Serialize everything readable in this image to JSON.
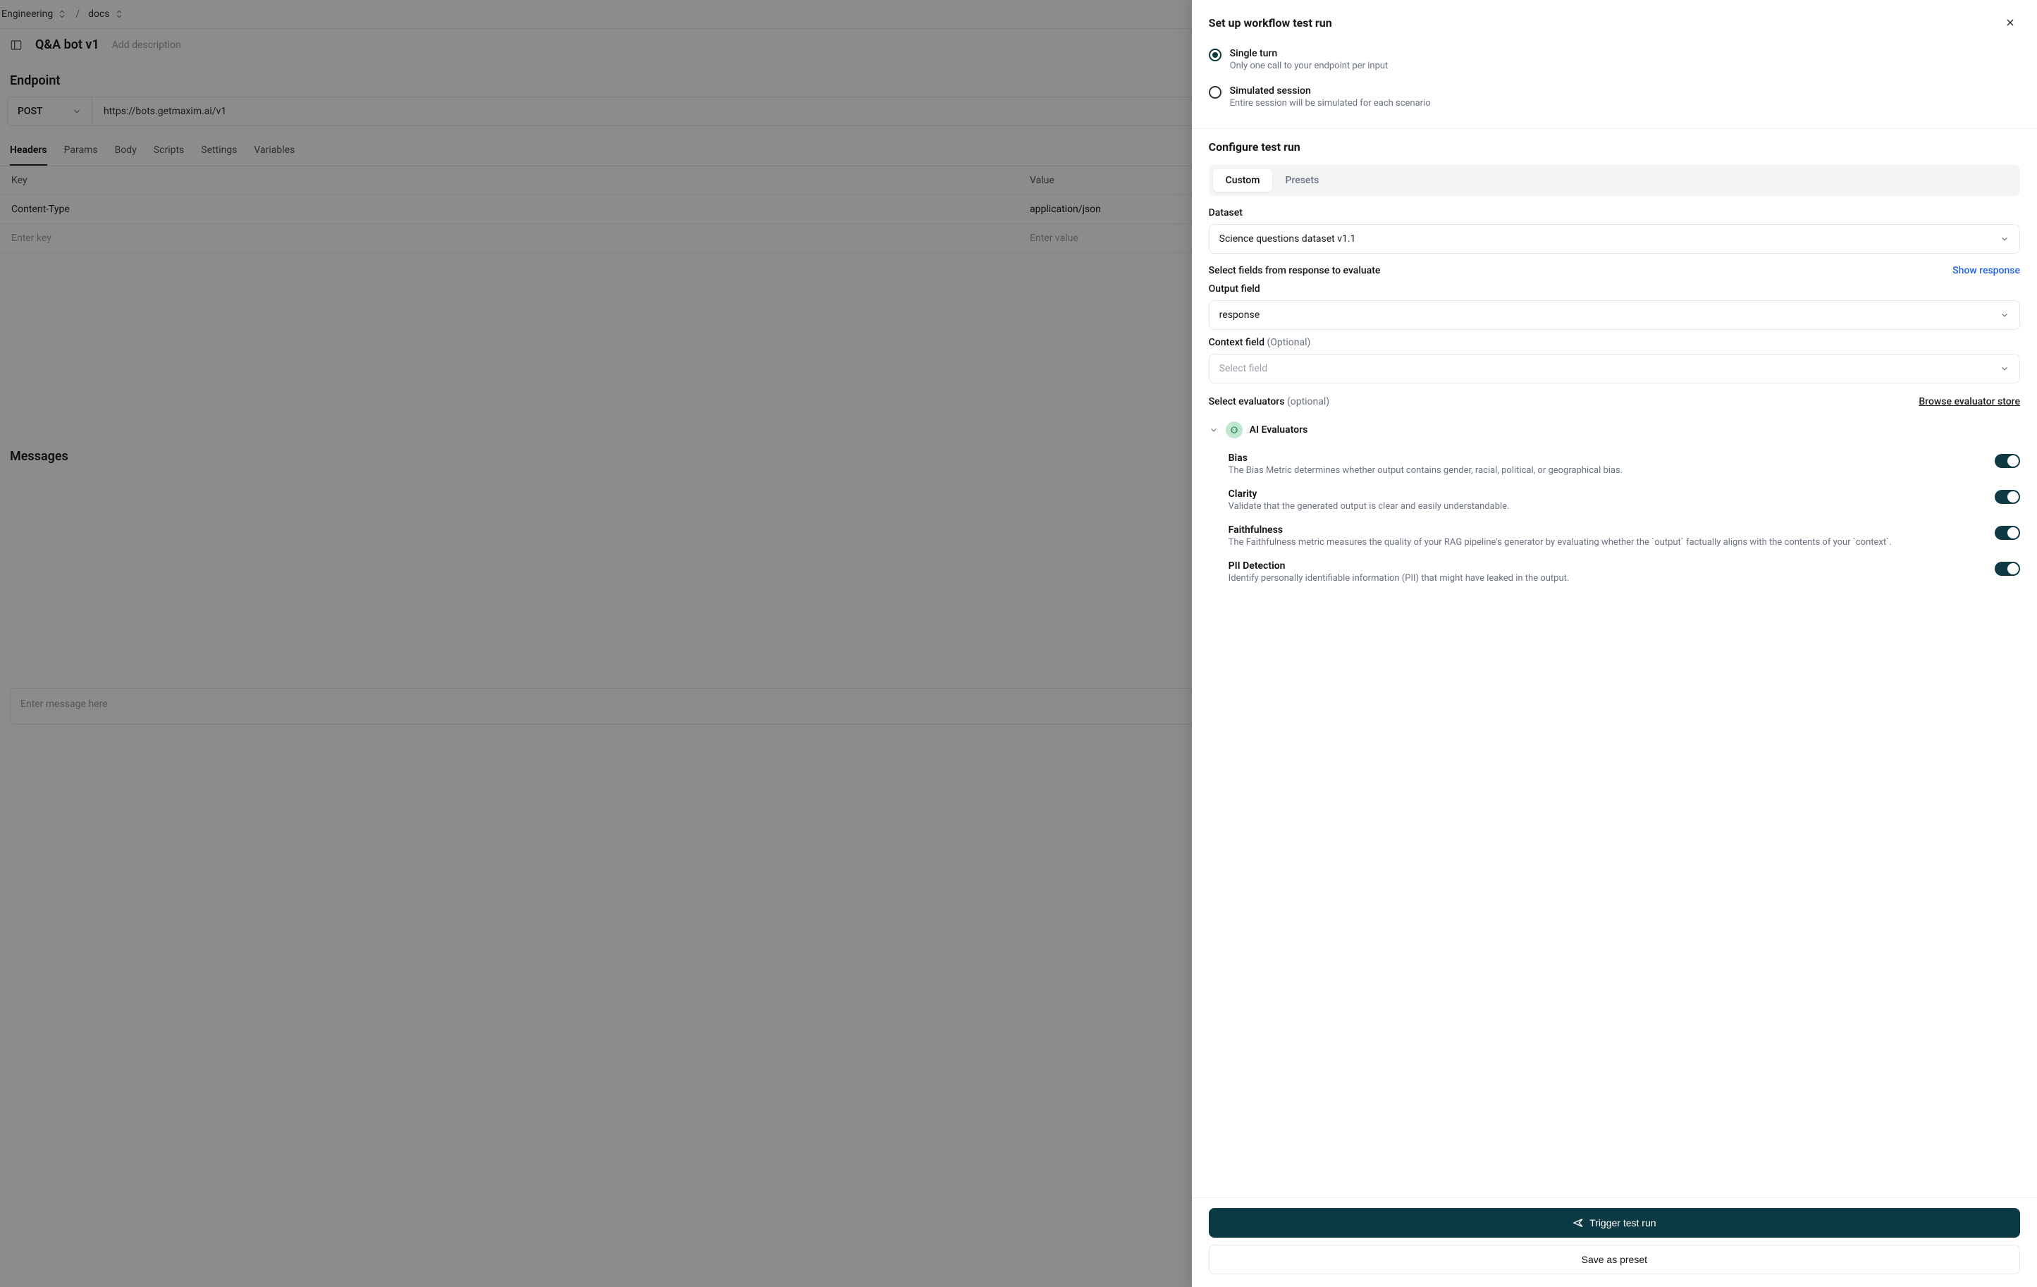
{
  "breadcrumb": {
    "items": [
      "Engineering",
      "docs"
    ]
  },
  "workflow": {
    "title": "Q&A bot v1",
    "add_description_placeholder": "Add description"
  },
  "endpoint": {
    "heading": "Endpoint",
    "method": "POST",
    "url": "https://bots.getmaxim.ai/v1"
  },
  "tabs": {
    "items": [
      "Headers",
      "Params",
      "Body",
      "Scripts",
      "Settings",
      "Variables"
    ],
    "active_index": 0
  },
  "headers_table": {
    "columns": [
      "Key",
      "Value"
    ],
    "rows": [
      {
        "key": "Content-Type",
        "value": "application/json"
      }
    ],
    "placeholders": {
      "key": "Enter key",
      "value": "Enter value"
    }
  },
  "messages": {
    "heading": "Messages",
    "input_placeholder": "Enter message here"
  },
  "drawer": {
    "title": "Set up workflow test run",
    "modes": [
      {
        "label": "Single turn",
        "desc": "Only one call to your endpoint per input",
        "selected": true
      },
      {
        "label": "Simulated session",
        "desc": "Entire session will be simulated for each scenario",
        "selected": false
      }
    ],
    "configure_heading": "Configure test run",
    "seg_tabs": [
      "Custom",
      "Presets"
    ],
    "seg_active_index": 0,
    "dataset_label": "Dataset",
    "dataset_value": "Science questions dataset v1.1",
    "fields_section_label": "Select fields from response to evaluate",
    "show_response_link": "Show response",
    "output_field_label": "Output field",
    "output_field_value": "response",
    "context_field_label": "Context field",
    "context_field_optional": "(Optional)",
    "context_field_placeholder": "Select field",
    "evaluators_label": "Select evaluators",
    "evaluators_optional": "(optional)",
    "browse_store_link": "Browse evaluator store",
    "evaluator_group_title": "AI Evaluators",
    "evaluators": [
      {
        "name": "Bias",
        "desc": "The Bias Metric determines whether output contains gender, racial, political, or geographical bias.",
        "on": true
      },
      {
        "name": "Clarity",
        "desc": "Validate that the generated output is clear and easily understandable.",
        "on": true
      },
      {
        "name": "Faithfulness",
        "desc": "The Faithfulness metric measures the quality of your RAG pipeline's generator by evaluating whether the `output` factually aligns with the contents of your `context`.",
        "on": true
      },
      {
        "name": "PII Detection",
        "desc": "Identify personally identifiable information (PII) that might have leaked in the output.",
        "on": true
      }
    ],
    "footer": {
      "trigger_label": "Trigger test run",
      "save_preset_label": "Save as preset"
    }
  }
}
